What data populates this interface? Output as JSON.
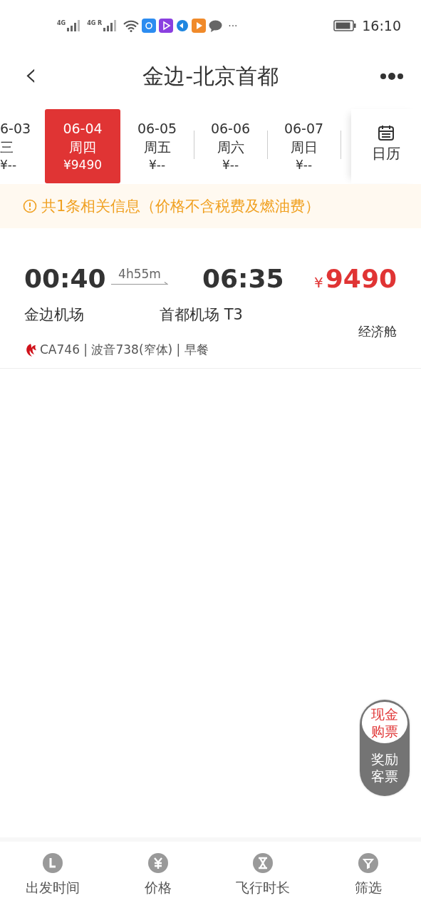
{
  "status_bar": {
    "networks": [
      "4G",
      "4G R"
    ],
    "more": "···",
    "time": "16:10"
  },
  "header": {
    "title": "金边-北京首都",
    "back": "‹"
  },
  "dates": [
    {
      "date": "6-03",
      "weekday": "三",
      "price": "¥--",
      "selected": false
    },
    {
      "date": "06-04",
      "weekday": "周四",
      "price": "¥9490",
      "selected": true
    },
    {
      "date": "06-05",
      "weekday": "周五",
      "price": "¥--",
      "selected": false
    },
    {
      "date": "06-06",
      "weekday": "周六",
      "price": "¥--",
      "selected": false
    },
    {
      "date": "06-07",
      "weekday": "周日",
      "price": "¥--",
      "selected": false
    }
  ],
  "calendar": {
    "label": "日历"
  },
  "notice": {
    "text": "共1条相关信息（价格不含税费及燃油费）"
  },
  "flights": [
    {
      "depart_time": "00:40",
      "duration": "4h55m",
      "arrive_time": "06:35",
      "currency": "¥",
      "price": "9490",
      "depart_airport": "金边机场",
      "arrive_airport": "首都机场 T3",
      "cabin": "经济舱",
      "info": "CA746 | 波音738(窄体) | 早餐"
    }
  ],
  "ticket_toggle": [
    {
      "label": "现金购票",
      "selected": true
    },
    {
      "label": "奖励客票",
      "selected": false
    }
  ],
  "bottom_nav": [
    {
      "kind": "clock",
      "label": "出发时间"
    },
    {
      "kind": "yen",
      "label": "价格"
    },
    {
      "kind": "hourglass",
      "label": "飞行时长"
    },
    {
      "kind": "filter",
      "label": "筛选"
    }
  ]
}
